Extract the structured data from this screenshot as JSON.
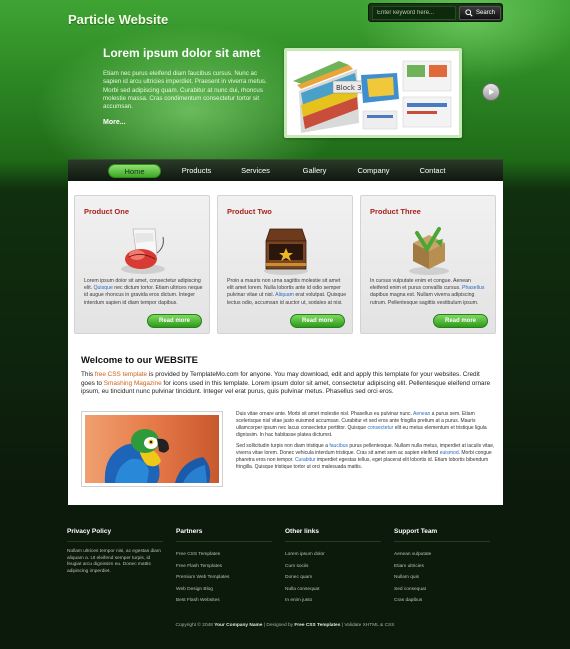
{
  "header": {
    "site_title": "Particle Website",
    "search": {
      "placeholder": "Enter keyword here...",
      "button_label": "Search"
    }
  },
  "hero": {
    "heading": "Lorem ipsum dolor sit amet",
    "text": "Etiam nec purus eleifend diam faucibus cursus. Nunc ac sapien id arcu ultricies imperdiet. Praesent in viverra metus. Morbi sed adipiscing quam. Curabitur at nunc dui, rhoncus molestie massa. Cras condimentum consectetur tortor sit accumsan.",
    "more_label": "More...",
    "image_caption": "Block 3D"
  },
  "nav": {
    "items": [
      "Home",
      "Products",
      "Services",
      "Gallery",
      "Company",
      "Contact"
    ],
    "active": "Home"
  },
  "products": [
    {
      "title": "Product One",
      "text_before": "Lorem ipsum dolor sit amet, consectetur adipiscing elit. ",
      "link": "Quisque",
      "text_after": " nec dictum tortor. Etiam ultrices neque id augue rhoncus in gravida eros dictum. Integer interdum sapien id diam tempor dapibus.",
      "button": "Read more"
    },
    {
      "title": "Product Two",
      "text_before": "Proin a mauris non urna sagittis molestie sit amet elit amet lorem. Nulla lobortis ante id odio semper pulvinar vitae ut nisl. ",
      "link": "Aliquam",
      "text_after": " erat volutpat. Quisque lectus odio, accumsan id auctor ut, sodales at nisi.",
      "button": "Read more"
    },
    {
      "title": "Product Three",
      "text_before": "In cursus vulputate enim et congue. Aenean eleifend enim et purus convallis cursus. ",
      "link": "Phasellus",
      "text_after": " dapibus magna est. Nullam viverra adipiscing rutrum. Pellentesque sagittis vestibulum ipsum.",
      "button": "Read more"
    }
  ],
  "welcome": {
    "title": "Welcome to our WEBSITE",
    "p_this": "This ",
    "link_template": "free CSS template",
    "p_mid1": " is provided by TemplateMo.com for anyone. You may download, edit and apply this template for your websites. Credit goes to ",
    "link_smashing": "Smashing Magazine",
    "p_mid2": " for icons used in this template. Lorem ipsum dolor sit amet, consectetur adipiscing elit. Pellentesque eleifend ornare ipsum, eu tincidunt nunc pulvinar tincidunt. Integer vel erat purus, quis pulvinar metus. Phasellus sed orci eros."
  },
  "article": {
    "p1_before": "Duis vitae ornare ante. Morbi sit amet molestie nisl. Phasellus eu pulvinar nunc. ",
    "p1_link1": "Aenean",
    "p1_mid": " a purus sem. Etiam scelerisque nisl vitae justo euismod accumsan. Curabitur et sed eros ante frisgilla pretium at a purus. Mauris ullamcorper ipsum nec lacus consectetur porttitor. Quisque ",
    "p1_link2": "consectetur",
    "p1_after": " elit eu metus elementum et tristique ligula dignissim. In hac habitasse platea dictumst.",
    "p2_before": "Sed sollicitudin turpis non diam tristique a ",
    "p2_link1": "faucibus",
    "p2_mid": " purus pellentesque. Nullam nulla metus, imperdiet at iaculis vitae, viverra vitae lorem. Donec vehicula interdum tristique. Cras sit amet sem ac sapien eleifend ",
    "p2_link2": "euismod",
    "p2_mid2": ". Morbi congue pharetra eros non tempor. ",
    "p2_link3": "Curabitur",
    "p2_after": " imperdiet egestas tellus, eget placerat elit lobortis id. Etiam lobortis bibendum fringilla. Quisque tristique tortor ut orci malesuada mattis."
  },
  "footer": {
    "privacy": {
      "title": "Privacy Policy",
      "text": "Nullam ultrices tempor nisi, ac egestas diam aliquam a. Ut eleifend semper turpis, id feugiat arcu dignissim eu. Donec mattis adipiscing imperdiet."
    },
    "partners": {
      "title": "Partners",
      "items": [
        "Free CSS Templates",
        "Free Flash Templates",
        "Premium Web Templates",
        "Web Design Blog",
        "Best Flash Websites"
      ]
    },
    "other_links": {
      "title": "Other links",
      "items": [
        "Lorem ipsum dolor",
        "Cum sociis",
        "Donec quam",
        "Nulla consequat",
        "In enim justo"
      ]
    },
    "support": {
      "title": "Support Team",
      "items": [
        "Aenean vulputate",
        "Etiam ultricies",
        "Nullam quis",
        "Sed consequat",
        "Cras dapibus"
      ]
    },
    "copyright_prefix": "Copyright © 2048 ",
    "company": "Your Company Name",
    "designed_by_prefix": " | Designed by ",
    "designer": "Free CSS Templates",
    "validate": " | Validate XHTML & CSS"
  },
  "colors": {
    "brand_green": "#3fa434",
    "product_title": "#a8231c",
    "button_green": "#2e9a1c",
    "link_blue": "#2a6ac0",
    "link_orange": "#d06018"
  },
  "icons": [
    "search-icon",
    "next-arrow-icon",
    "mouse-icon",
    "treasure-chest-icon",
    "package-icon",
    "parrot-photo"
  ]
}
